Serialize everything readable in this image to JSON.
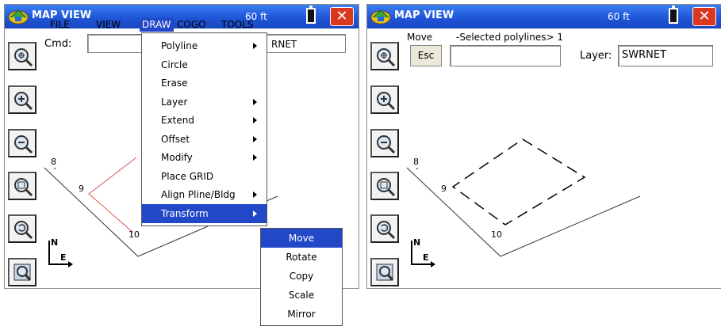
{
  "left": {
    "title": "MAP VIEW",
    "scale": "60 ft",
    "close": "✕",
    "menu": [
      "FILE",
      "VIEW",
      "DRAW",
      "COGO",
      "TOOLS"
    ],
    "active_menu": "DRAW",
    "cmd_label": "Cmd:",
    "layer_partial": "RNET",
    "point_labels": [
      "8",
      "9",
      "10"
    ],
    "north": "N",
    "east": "E",
    "draw_menu": [
      {
        "label": "Polyline",
        "submenu": true
      },
      {
        "label": "Circle",
        "submenu": false
      },
      {
        "label": "Erase",
        "submenu": false
      },
      {
        "label": "Layer",
        "submenu": true
      },
      {
        "label": "Extend",
        "submenu": true
      },
      {
        "label": "Offset",
        "submenu": true
      },
      {
        "label": "Modify",
        "submenu": true
      },
      {
        "label": "Place GRID",
        "submenu": false
      },
      {
        "label": "Align Pline/Bldg",
        "submenu": true
      },
      {
        "label": "Transform",
        "submenu": true
      }
    ],
    "highlighted_item": "Transform",
    "transform_submenu": [
      "Move",
      "Rotate",
      "Copy",
      "Scale",
      "Mirror"
    ],
    "highlighted_sub": "Move"
  },
  "right": {
    "title": "MAP VIEW",
    "scale": "60 ft",
    "close": "✕",
    "command": "Move",
    "prompt": "-Selected polylines> 1",
    "esc_label": "Esc",
    "layer_label": "Layer:",
    "layer_value": "SWRNET",
    "point_labels": [
      "8",
      "9",
      "10"
    ],
    "north": "N",
    "east": "E"
  },
  "toolbar_icons": [
    "zoom-extents-icon",
    "zoom-in-icon",
    "zoom-out-icon",
    "zoom-window-icon",
    "zoom-previous-icon",
    "zoom-realtime-icon"
  ],
  "colors": {
    "titlebar": "#2153d6",
    "menu_highlight": "#2248c8",
    "selected_polyline": "#e05050",
    "close": "#d9381e"
  }
}
